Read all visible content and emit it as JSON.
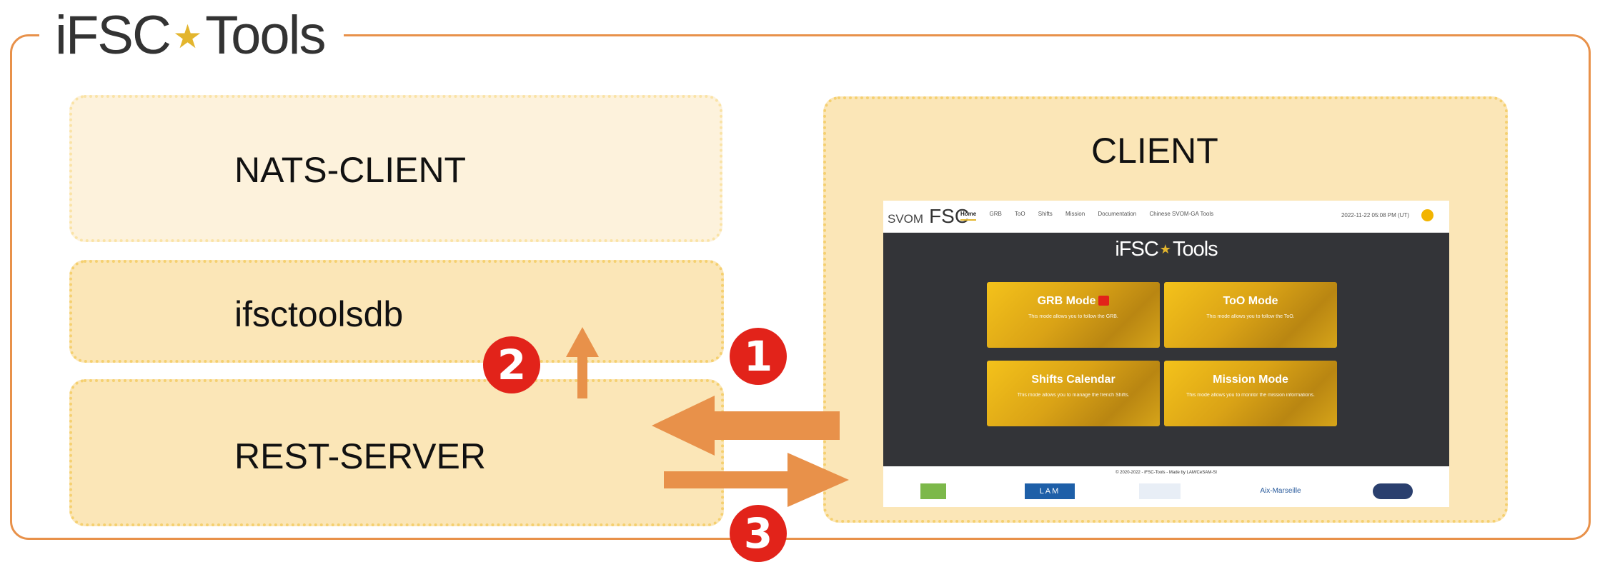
{
  "frame": {
    "title_left": "iFSC",
    "title_star": "★",
    "title_right": "Tools"
  },
  "boxes": {
    "nats_client": "NATS-CLIENT",
    "database": "ifsctoolsdb",
    "rest_server": "REST-SERVER",
    "client": "CLIENT"
  },
  "badges": {
    "one": "1",
    "two": "2",
    "three": "3"
  },
  "colors": {
    "frame": "#e8914a",
    "arrow": "#e8914a",
    "badge": "#e2231a",
    "box_fill": "#fbe6b7",
    "box_fill_light": "#fdf2dc",
    "box_border": "#f5d070"
  },
  "screenshot": {
    "logo_svom": "SVOM",
    "logo_fsc": "FSC",
    "nav": [
      "Home",
      "GRB",
      "ToO",
      "Shifts",
      "Mission",
      "Documentation",
      "Chinese SVOM-GA Tools"
    ],
    "datetime": "2022-11-22 05:08 PM (UT)",
    "title_left": "iFSC",
    "title_star": "★",
    "title_right": "Tools",
    "cards": {
      "grb": {
        "title": "GRB Mode",
        "desc": "This mode allows you to follow the GRB."
      },
      "too": {
        "title": "ToO Mode",
        "desc": "This mode allows you to follow the ToO."
      },
      "shifts": {
        "title": "Shifts Calendar",
        "desc": "This mode allows you to manage the french Shifts."
      },
      "mission": {
        "title": "Mission Mode",
        "desc": "This mode allows you to monitor the mission informations."
      }
    },
    "footer": {
      "copyright": "© 2020-2022 - iFSC-Tools - Made by LAM/CeSAM-SI",
      "lam": "LAM",
      "aix": "Aix-Marseille"
    }
  }
}
